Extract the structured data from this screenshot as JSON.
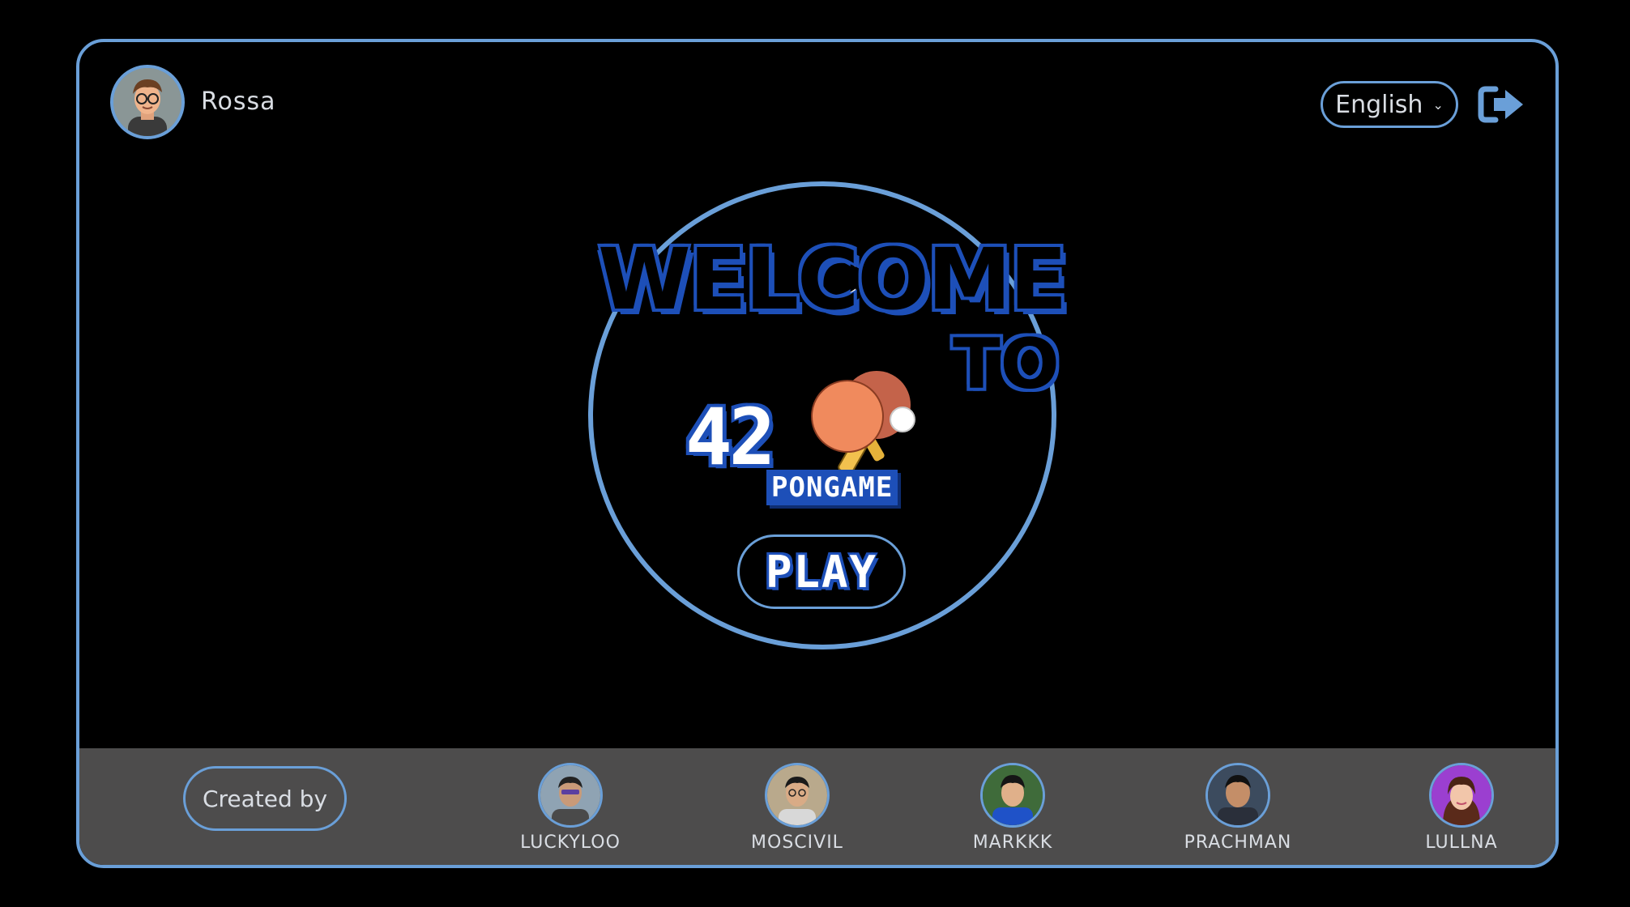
{
  "header": {
    "username": "Rossa",
    "language": "English"
  },
  "hero": {
    "welcome": "WELCOME",
    "to": "TO",
    "logo_number": "42",
    "logo_word": "PONGAME",
    "play_label": "PLAY"
  },
  "footer": {
    "created_by": "Created by",
    "members": [
      {
        "name": "LUCKYLOO"
      },
      {
        "name": "MOSCIVIL"
      },
      {
        "name": "MARKKK"
      },
      {
        "name": "PRACHMAN"
      },
      {
        "name": "LULLNA"
      }
    ]
  },
  "colors": {
    "accent": "#6a9fd8",
    "logo_blue": "#1d4fb8",
    "footer_bg": "#4d4c4c",
    "paddle": "#f08a5d"
  },
  "icons": [
    "avatar",
    "logout-icon",
    "chevron-down-icon",
    "ping-pong-paddles-icon"
  ]
}
